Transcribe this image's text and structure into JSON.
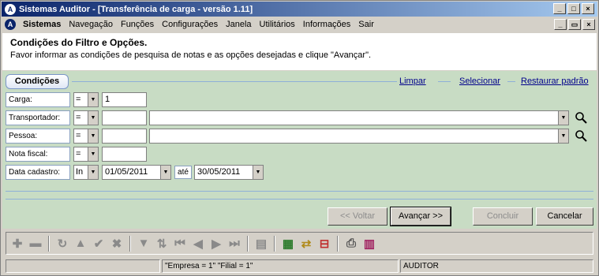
{
  "window": {
    "title": "Sistemas Auditor - [Transferência de carga - versão 1.11]",
    "app_icon": "A",
    "btn_min": "_",
    "btn_max": "□",
    "btn_close": "×",
    "mdi_min": "_",
    "mdi_restore": "▭",
    "mdi_close": "×"
  },
  "menu": {
    "items": [
      "Sistemas",
      "Navegação",
      "Funções",
      "Configurações",
      "Janela",
      "Utilitários",
      "Informações",
      "Sair"
    ]
  },
  "header": {
    "title": "Condições do Filtro e Opções.",
    "subtitle": "Favor informar as condições de pesquisa de notas e as opções desejadas e clique \"Avançar\"."
  },
  "tabs": {
    "active": "Condições",
    "links": [
      "Limpar",
      "Selecionar",
      "Restaurar padrão"
    ]
  },
  "filters": {
    "carga": {
      "label": "Carga:",
      "op": "=",
      "value": "1"
    },
    "transportador": {
      "label": "Transportador:",
      "op": "=",
      "code": "",
      "name": ""
    },
    "pessoa": {
      "label": "Pessoa:",
      "op": "=",
      "code": "",
      "name": ""
    },
    "nota_fiscal": {
      "label": "Nota fiscal:",
      "op": "=",
      "value": ""
    },
    "data_cadastro": {
      "label": "Data cadastro:",
      "op": "In",
      "from": "01/05/2011",
      "to_label": "até",
      "to": "30/05/2011"
    }
  },
  "buttons": {
    "voltar": "<< Voltar",
    "avancar": "Avançar >>",
    "concluir": "Concluir",
    "cancelar": "Cancelar"
  },
  "toolbar_icons": [
    "plus-icon",
    "minus-icon",
    "refresh-icon",
    "up-icon",
    "check-icon",
    "cancel-icon",
    "filter-icon",
    "sort-icon",
    "first-icon",
    "prev-icon",
    "next-icon",
    "last-icon",
    "export-icon",
    "add-row-icon",
    "transfer-icon",
    "remove-icon",
    "print-icon",
    "config-icon"
  ],
  "status": {
    "empresa": "\"Empresa = 1\"   \"Filial = 1\"",
    "user": "AUDITOR"
  },
  "colors": {
    "title_start": "#0a246a",
    "title_end": "#a6caf0",
    "panel": "#c8dcc4",
    "link": "#00008b"
  }
}
